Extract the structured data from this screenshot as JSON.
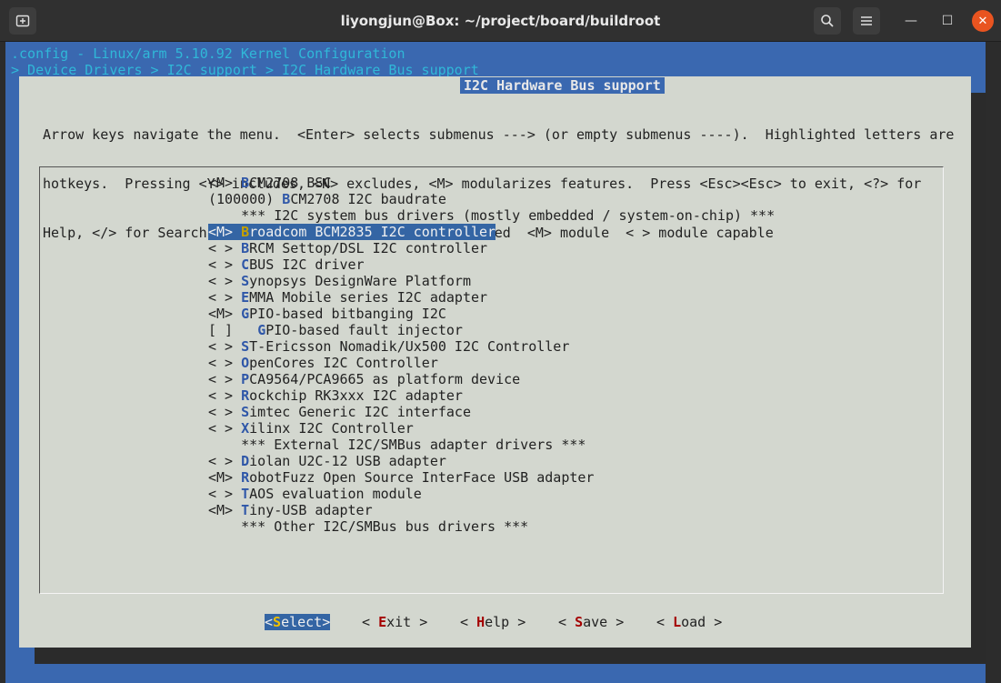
{
  "window": {
    "title": "liyongjun@Box: ~/project/board/buildroot",
    "new_tab_icon": "new-tab-icon",
    "search_icon": "search-icon",
    "menu_icon": "hamburger-menu-icon",
    "minimize_glyph": "—",
    "maximize_glyph": "☐",
    "close_glyph": "✕"
  },
  "terminal": {
    "config_line": ".config - Linux/arm 5.10.92 Kernel Configuration",
    "breadcrumb": "> Device Drivers > I2C support > I2C Hardware Bus support"
  },
  "dialog": {
    "title": "I2C Hardware Bus support",
    "help_lines": [
      "Arrow keys navigate the menu.  <Enter> selects submenus ---> (or empty submenus ----).  Highlighted letters are",
      "hotkeys.  Pressing <Y> includes, <N> excludes, <M> modularizes features.  Press <Esc><Esc> to exit, <?> for",
      "Help, </> for Search.  Legend: [*] built-in  [ ] excluded  <M> module  < > module capable"
    ],
    "items": [
      {
        "prefix": "<M> ",
        "hotkey": "B",
        "rest": "CM2708 BSC"
      },
      {
        "prefix": "(100000) ",
        "hotkey": "B",
        "rest": "CM2708 I2C baudrate"
      },
      {
        "prefix": "",
        "hotkey": "",
        "rest": "    *** I2C system bus drivers (mostly embedded / system-on-chip) ***"
      },
      {
        "prefix": "<M> ",
        "hotkey": "B",
        "rest": "roadcom BCM2835 I2C controller",
        "selected": true
      },
      {
        "prefix": "< > ",
        "hotkey": "B",
        "rest": "RCM Settop/DSL I2C controller"
      },
      {
        "prefix": "< > ",
        "hotkey": "C",
        "rest": "BUS I2C driver"
      },
      {
        "prefix": "< > ",
        "hotkey": "S",
        "rest": "ynopsys DesignWare Platform"
      },
      {
        "prefix": "< > ",
        "hotkey": "E",
        "rest": "MMA Mobile series I2C adapter"
      },
      {
        "prefix": "<M> ",
        "hotkey": "G",
        "rest": "PIO-based bitbanging I2C"
      },
      {
        "prefix": "[ ]   ",
        "hotkey": "G",
        "rest": "PIO-based fault injector"
      },
      {
        "prefix": "< > ",
        "hotkey": "S",
        "rest": "T-Ericsson Nomadik/Ux500 I2C Controller"
      },
      {
        "prefix": "< > ",
        "hotkey": "O",
        "rest": "penCores I2C Controller"
      },
      {
        "prefix": "< > ",
        "hotkey": "P",
        "rest": "CA9564/PCA9665 as platform device"
      },
      {
        "prefix": "< > ",
        "hotkey": "R",
        "rest": "ockchip RK3xxx I2C adapter"
      },
      {
        "prefix": "< > ",
        "hotkey": "S",
        "rest": "imtec Generic I2C interface"
      },
      {
        "prefix": "< > ",
        "hotkey": "X",
        "rest": "ilinx I2C Controller"
      },
      {
        "prefix": "",
        "hotkey": "",
        "rest": "    *** External I2C/SMBus adapter drivers ***"
      },
      {
        "prefix": "< > ",
        "hotkey": "D",
        "rest": "iolan U2C-12 USB adapter"
      },
      {
        "prefix": "<M> ",
        "hotkey": "R",
        "rest": "obotFuzz Open Source InterFace USB adapter"
      },
      {
        "prefix": "< > ",
        "hotkey": "T",
        "rest": "AOS evaluation module"
      },
      {
        "prefix": "<M> ",
        "hotkey": "T",
        "rest": "iny-USB adapter"
      },
      {
        "prefix": "",
        "hotkey": "",
        "rest": "    *** Other I2C/SMBus bus drivers ***"
      }
    ],
    "buttons": [
      {
        "left": "<",
        "hotkey": "S",
        "rest": "elect>",
        "active": true
      },
      {
        "left": "< ",
        "hotkey": "E",
        "rest": "xit >"
      },
      {
        "left": "< ",
        "hotkey": "H",
        "rest": "elp >"
      },
      {
        "left": "< ",
        "hotkey": "S",
        "rest": "ave >"
      },
      {
        "left": "< ",
        "hotkey": "L",
        "rest": "oad >"
      }
    ]
  },
  "colors": {
    "terminal_bg": "#3a68b0",
    "dialog_bg": "#d3d7cf",
    "highlight": "#3465a4",
    "hotkey_blue": "#2f57a8",
    "hotkey_red": "#a40000",
    "header_cyan": "#30b8d8",
    "close_orange": "#e95420"
  }
}
